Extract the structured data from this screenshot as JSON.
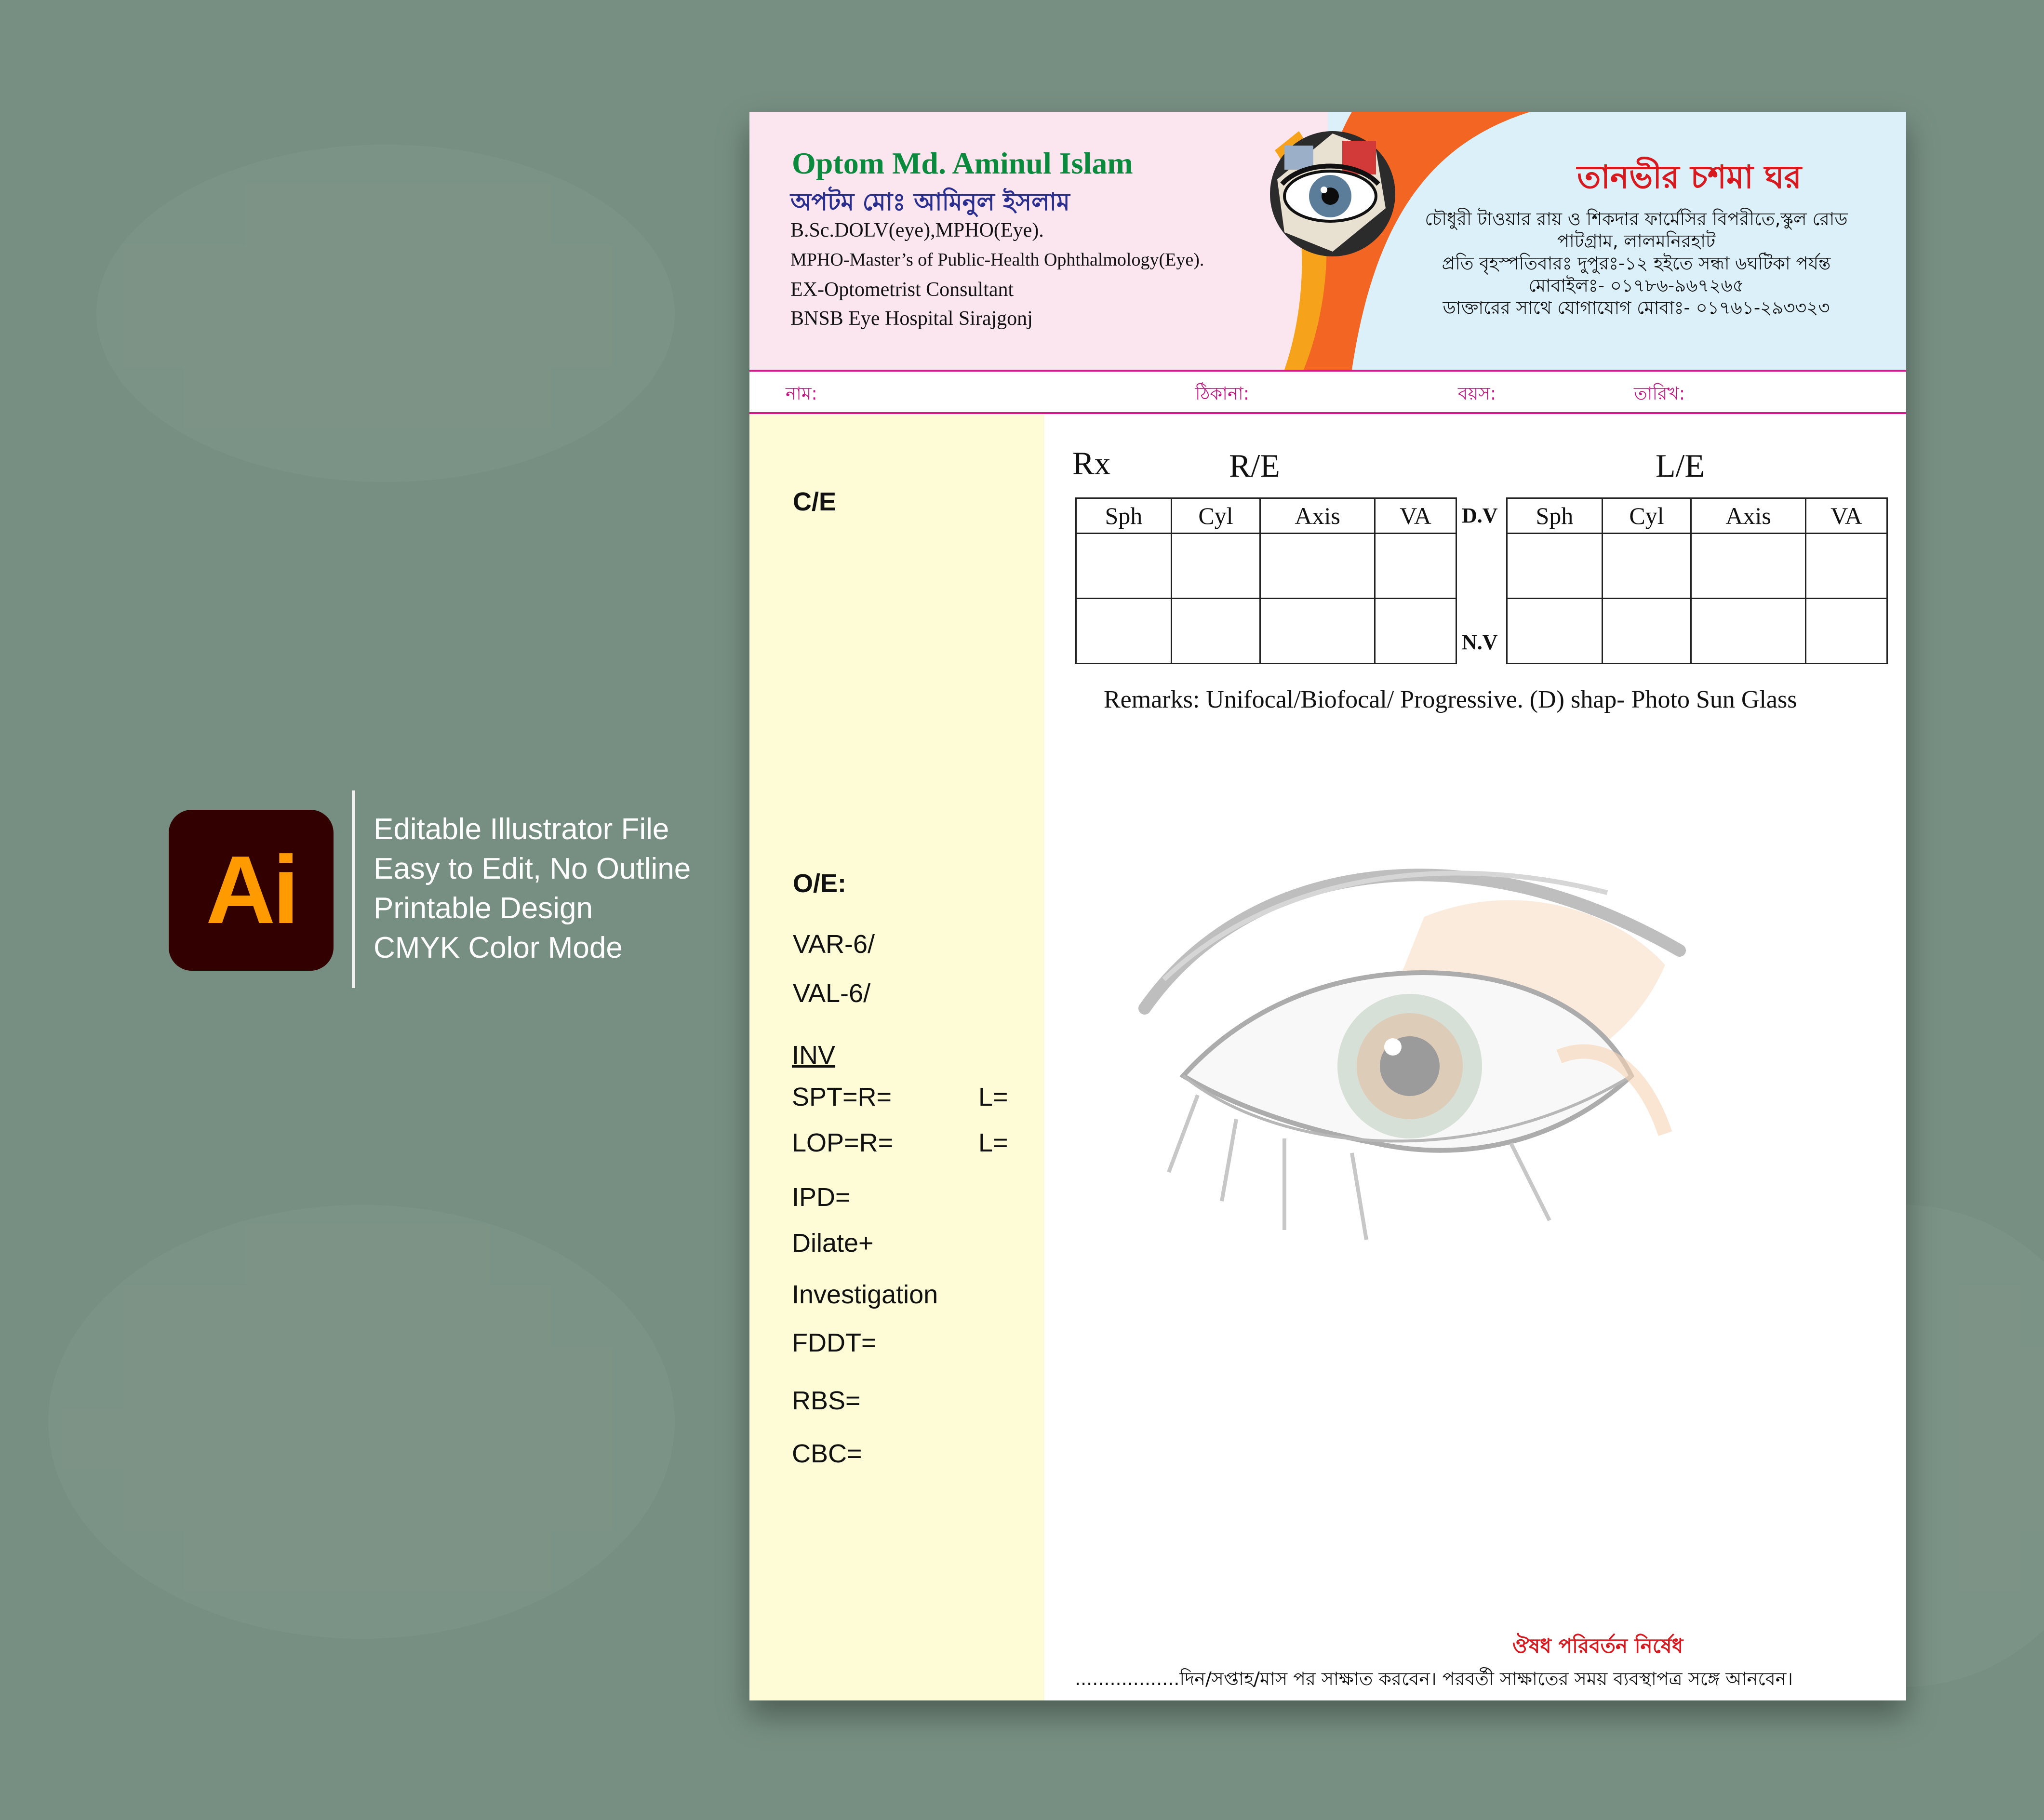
{
  "promo": {
    "logo_text": "Ai",
    "features": [
      "Editable Illustrator File",
      "Easy to Edit, No Outline",
      "Printable Design",
      "CMYK Color Mode"
    ]
  },
  "header": {
    "doctor_name_en": "Optom Md. Aminul Islam",
    "doctor_name_bn": "অপটম মোঃ আমিনুল ইসলাম",
    "degree": "B.Sc.DOLV(eye),MPHO(Eye).",
    "degree_full": "MPHO-Master’s of Public-Health Ophthalmology(Eye).",
    "position": "EX-Optometrist Consultant",
    "hospital": "BNSB Eye Hospital Sirajgonj",
    "clinic_name": "তানভীর চশমা ঘর",
    "clinic_lines": [
      "চৌধুরী টাওয়ার রায় ও শিকদার ফার্মেসির বিপরীতে,স্কুল রোড",
      "পাটগ্রাম, লালমনিরহাট",
      "প্রতি বৃহস্পতিবারঃ দুপুরঃ-১২ হইতে সন্ধা ৬ঘটিকা পর্যন্ত",
      "মোবাইলঃ- ০১৭৮৬-৯৬৭২৬৫",
      "ডাক্তারের সাথে যোগাযোগ মোবাঃ- ০১৭৬১-২৯৩৩২৩"
    ]
  },
  "patient_fields": {
    "name": "নাম:",
    "address": "ঠিকানা:",
    "age": "বয়স:",
    "date": "তারিখ:"
  },
  "sidebar": {
    "ce": "C/E",
    "oe": "O/E:",
    "var": "VAR-6/",
    "val": "VAL-6/",
    "inv": "INV",
    "spt": "SPT=R=",
    "spt_l": "L=",
    "lop": "LOP=R=",
    "lop_l": "L=",
    "ipd": "IPD=",
    "dilate": "Dilate+",
    "investigation": "Investigation",
    "fddt": "FDDT=",
    "rbs": "RBS=",
    "cbc": "CBC="
  },
  "rx": {
    "rx_label": "Rx",
    "re_label": "R/E",
    "le_label": "L/E",
    "columns": [
      "Sph",
      "Cyl",
      "Axis",
      "VA"
    ],
    "dv": "D.V",
    "nv": "N.V",
    "remarks": "Remarks: Unifocal/Biofocal/ Progressive. (D) shap- Photo Sun Glass"
  },
  "footer": {
    "warning": "ঔষধ পরিবর্তন নির্ষেধ",
    "followup": "..................দিন/সপ্তাহ/মাস পর সাক্ষাত করবেন। পরবর্তী সাক্ষাতের সময় ব্যবস্থাপত্র সঙ্গে আনবেন।"
  },
  "colors": {
    "background": "#778f82",
    "header_left": "#fbe6ef",
    "header_right": "#dcf0f9",
    "doctor_name": "#0a8a3c",
    "clinic_name": "#d71920",
    "field_labels": "#c01680",
    "sidebar": "#fefcd6",
    "swoosh": "#f26522"
  }
}
